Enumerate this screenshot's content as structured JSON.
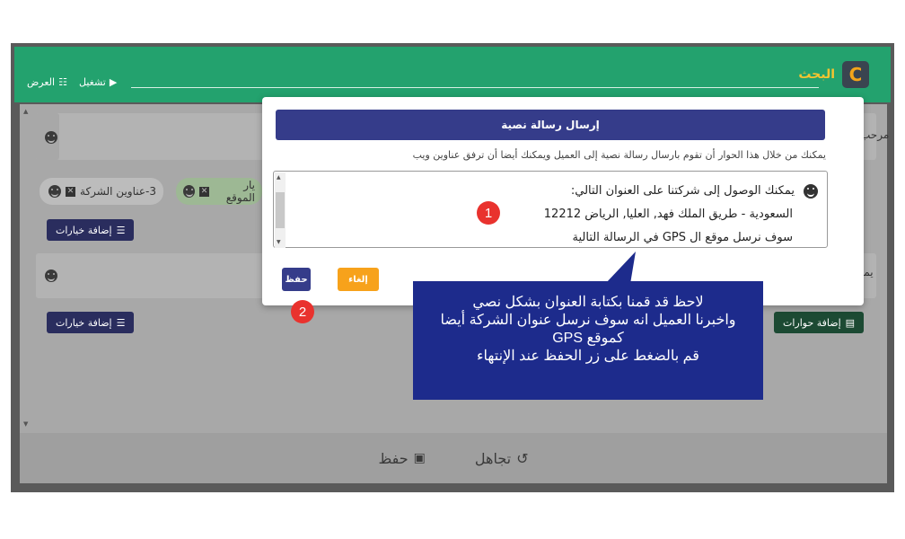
{
  "topbar": {
    "brand": "البحث",
    "run_label": "تشغيل",
    "view_label": "العرض"
  },
  "cards": {
    "welcome_label": "مرحب",
    "second_label": "يمكنك",
    "chip_company": "3-عناوين الشركة",
    "chip_location": "يار الموقع",
    "add_options_1": "إضافة خيارات",
    "add_options_2": "إضافة خيارات",
    "add_dialogs": "إضافة حوارات"
  },
  "modal": {
    "title": "إرسال رسالة نصية",
    "description": "يمكنك من خلال هذا الحوار أن تقوم بارسال رسالة نصية إلى العميل ويمكنك أيضا أن ترفق عناوين ويب",
    "lines": [
      "يمكنك الوصول إلى شركتنا على العنوان التالي:",
      "السعودية - طريق الملك فهد, العليا, الرياض 12212",
      "سوف نرسل موقع ال GPS في الرسالة التالية"
    ],
    "save_label": "حفظ",
    "cancel_label": "إلغاء"
  },
  "callout": {
    "line1": "لاحظ قد قمنا بكتابة العنوان بشكل نصي",
    "line2": "واخبرنا العميل انه سوف نرسل عنوان الشركة أيضا",
    "line3": "كموقع GPS",
    "line4": "قم بالضغط على زر الحفظ عند الإنتهاء"
  },
  "badges": {
    "one": "1",
    "two": "2"
  },
  "bottombar": {
    "save_label": "حفظ",
    "ignore_label": "تجاهل"
  }
}
